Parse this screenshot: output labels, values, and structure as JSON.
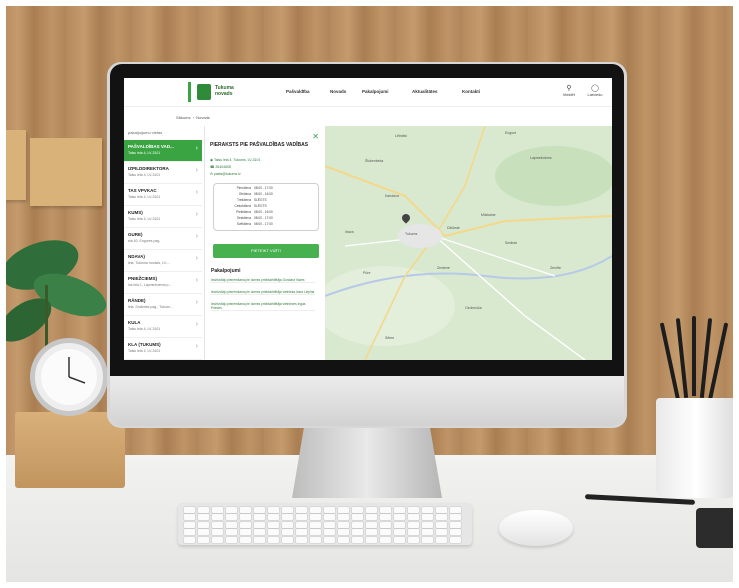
{
  "website": {
    "brand": {
      "line1": "Tukuma",
      "line2": "novads"
    },
    "nav": [
      "Pašvaldība",
      "Novads",
      "Pakalpojumi",
      "Aktualitātes",
      "Kontakti"
    ],
    "top_icons": [
      {
        "name": "search-icon",
        "label": "Meklēt"
      },
      {
        "name": "globe-icon",
        "label": "Latviešu"
      }
    ],
    "breadcrumb": [
      "Sākums",
      "Novads"
    ],
    "list_header": "pakalpojumu vietas",
    "list_items": [
      {
        "title": "PAŠVALDĪBAS VAD...",
        "sub": "Talsu iela 4, LV-3101",
        "active": true
      },
      {
        "title": "IZPILDDIREKTORA",
        "sub": "Talsu iela 4, LV-3101",
        "active": false
      },
      {
        "title": "TAS VPVKAC",
        "sub": "Talsu iela 4, LV-3101",
        "active": false
      },
      {
        "title": "KUMS)",
        "sub": "Talsu iela 4, LV-3101",
        "active": false
      },
      {
        "title": "GURE)",
        "sub": "ela 40, Engures pag.",
        "active": false
      },
      {
        "title": "NDAVA)",
        "sub": "iela, Tukuma novads, LV-...",
        "active": false
      },
      {
        "title": "PNIEŽCIEMS)",
        "sub": "lus iela 1, Lapmežciema p...",
        "active": false
      },
      {
        "title": "RĀNDE)",
        "sub": "iela, Smārdes pag., Tukum...",
        "active": false
      },
      {
        "title": "KULA",
        "sub": "Talsu iela 4, LV-3101",
        "active": false
      },
      {
        "title": "KLA (TUKUMS)",
        "sub": "Talsu iela 4, LV-3101",
        "active": false
      }
    ],
    "panel": {
      "title": "PIERAKSTS PIE PAŠVALDĪBAS VADĪBAS",
      "address": "Talsu iela 4, Tukums, LV-3101",
      "phone": "26404608",
      "email": "pasts@tukums.lv",
      "hours": [
        [
          "Pirmdiena",
          "08:00 - 17:00"
        ],
        [
          "Otrdiena",
          "08:00 - 16:00"
        ],
        [
          "Trešdiena",
          "SLĒGTS"
        ],
        [
          "Ceturtdiena",
          "SLĒGTS"
        ],
        [
          "Piektdiena",
          "08:00 - 16:00"
        ],
        [
          "Sestdiena",
          "08:00 - 17:00"
        ],
        [
          "Svētdiena",
          "08:00 - 17:00"
        ]
      ],
      "button": "PIETEIKT VIZĪTI",
      "services_heading": "Pakalpojumi",
      "services": [
        "Iedzīvotāju pieņemšana pie domes priekšsēdētāja Gundara Vazes",
        "Iedzīvotāju pieņemšana pie domes priekšsēdētāja vietnieka Ivara Liepiņa",
        "Iedzīvotāju pieņemšana pie domes priekšsēdētāja vietnieces Ingas Priedes"
      ]
    },
    "map_labels": [
      "Lētnieki",
      "Šlokenbeka",
      "Tukums",
      "Irlava",
      "Milzkalne",
      "Kandava",
      "Engure",
      "Lapmežciems",
      "Zentene",
      "Pūre",
      "Smārde",
      "Zemīte",
      "Ozolmuiža",
      "Džūkste",
      "Sēme"
    ]
  },
  "colors": {
    "accent": "#3aa443",
    "map": "#d9e9d0",
    "wall": "#b58a5e"
  }
}
